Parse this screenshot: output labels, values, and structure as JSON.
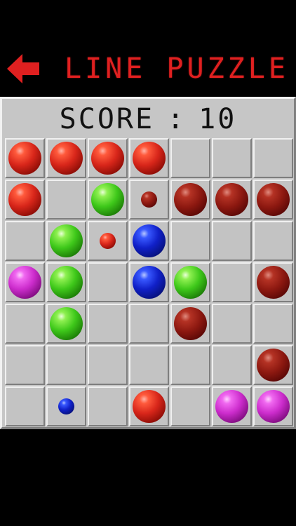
{
  "header": {
    "title": "LINE PUZZLE",
    "back_icon": "left-arrow-icon",
    "accent_color": "#e02020"
  },
  "score": {
    "label": "SCORE",
    "separator": ":",
    "value": "10"
  },
  "board": {
    "rows": 7,
    "cols": 7,
    "cells": [
      [
        {
          "ball": "red",
          "size": "large"
        },
        {
          "ball": "red",
          "size": "large"
        },
        {
          "ball": "red",
          "size": "large"
        },
        {
          "ball": "red",
          "size": "large"
        },
        null,
        null,
        null
      ],
      [
        {
          "ball": "red",
          "size": "large"
        },
        null,
        {
          "ball": "green",
          "size": "large"
        },
        {
          "ball": "darkred",
          "size": "small"
        },
        {
          "ball": "darkred",
          "size": "large"
        },
        {
          "ball": "darkred",
          "size": "large"
        },
        {
          "ball": "darkred",
          "size": "large"
        }
      ],
      [
        null,
        {
          "ball": "green",
          "size": "large"
        },
        {
          "ball": "red",
          "size": "small"
        },
        {
          "ball": "blue",
          "size": "large"
        },
        null,
        null,
        null
      ],
      [
        {
          "ball": "magenta",
          "size": "large"
        },
        {
          "ball": "green",
          "size": "large"
        },
        null,
        {
          "ball": "blue",
          "size": "large"
        },
        {
          "ball": "green",
          "size": "large"
        },
        null,
        {
          "ball": "darkred",
          "size": "large"
        }
      ],
      [
        null,
        {
          "ball": "green",
          "size": "large"
        },
        null,
        null,
        {
          "ball": "darkred",
          "size": "large"
        },
        null,
        null
      ],
      [
        null,
        null,
        null,
        null,
        null,
        null,
        {
          "ball": "darkred",
          "size": "large"
        }
      ],
      [
        null,
        {
          "ball": "blue",
          "size": "small"
        },
        null,
        {
          "ball": "red",
          "size": "large"
        },
        null,
        {
          "ball": "magenta",
          "size": "large"
        },
        {
          "ball": "magenta",
          "size": "large"
        }
      ]
    ]
  }
}
